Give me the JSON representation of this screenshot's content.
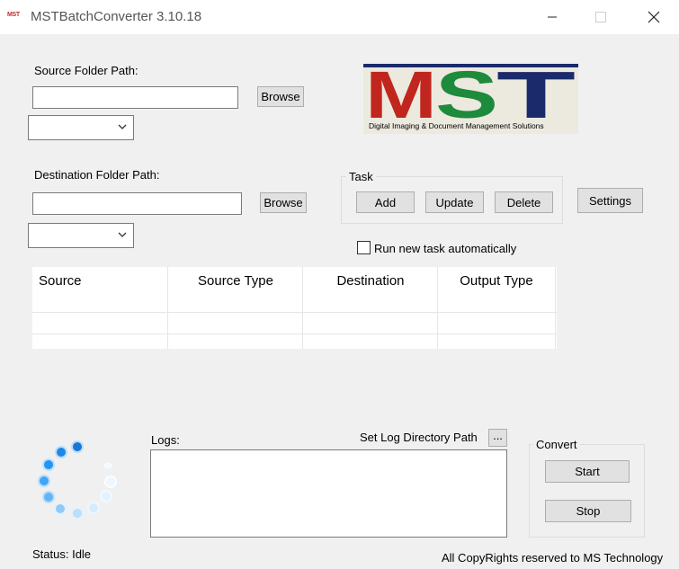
{
  "window": {
    "title": "MSTBatchConverter 3.10.18",
    "icon_text": "MST",
    "minimize_label": "—",
    "maximize_label": "☐",
    "close_label": "✕"
  },
  "source": {
    "label": "Source Folder Path:",
    "path_value": "",
    "browse_label": "Browse",
    "type_selected": ""
  },
  "destination": {
    "label": "Destination Folder Path:",
    "path_value": "",
    "browse_label": "Browse",
    "type_selected": ""
  },
  "logo": {
    "letters": "MST",
    "tagline": "Digital Imaging & Document Management Solutions",
    "colors": {
      "m": "#c0261e",
      "s": "#1e8a3c",
      "t": "#1b2a6b"
    }
  },
  "task": {
    "group_label": "Task",
    "add_label": "Add",
    "update_label": "Update",
    "delete_label": "Delete"
  },
  "settings_label": "Settings",
  "auto_task": {
    "label": "Run new task automatically",
    "checked": false
  },
  "tasks_table": {
    "columns": [
      "Source",
      "Source Type",
      "Destination",
      "Output Type"
    ],
    "rows": []
  },
  "logs": {
    "label": "Logs:",
    "set_dir_label": "Set Log Directory Path",
    "dir_button_label": "...",
    "content": ""
  },
  "convert": {
    "group_label": "Convert",
    "start_label": "Start",
    "stop_label": "Stop"
  },
  "status": {
    "text": "Status: Idle"
  },
  "footer": {
    "copyright": "All CopyRights reserved to MS Technology"
  },
  "colors": {
    "spinner_dark": "#1565c0",
    "spinner_mid": "#42a5f5",
    "spinner_light": "#bbdefb"
  }
}
